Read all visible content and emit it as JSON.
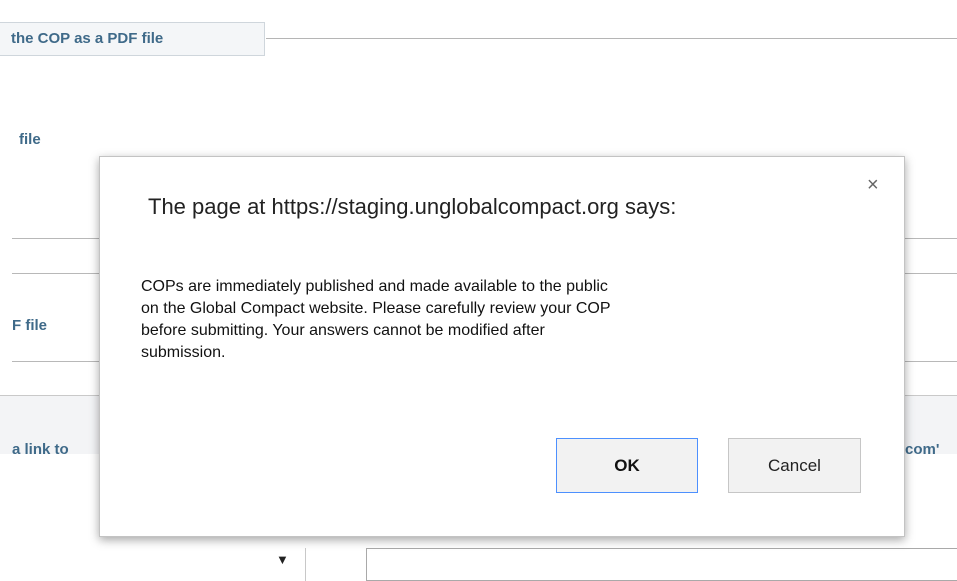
{
  "background": {
    "fieldset_legend": "the COP as a PDF file",
    "label_file": "file",
    "label_pdf_file": "F file",
    "label_link": "a link to",
    "label_right_clipped": "com'",
    "select_arrow": "▼"
  },
  "dialog": {
    "title": "The page at https://staging.unglobalcompact.org says:",
    "close_glyph": "×",
    "message": "COPs are immediately published and made available to the public\non the Global Compact website. Please carefully review your COP\nbefore submitting. Your answers cannot be modified after\nsubmission.",
    "ok_label": "OK",
    "cancel_label": "Cancel"
  },
  "colors": {
    "label_blue": "#3f6a89",
    "focus_border": "#4d90fe"
  }
}
